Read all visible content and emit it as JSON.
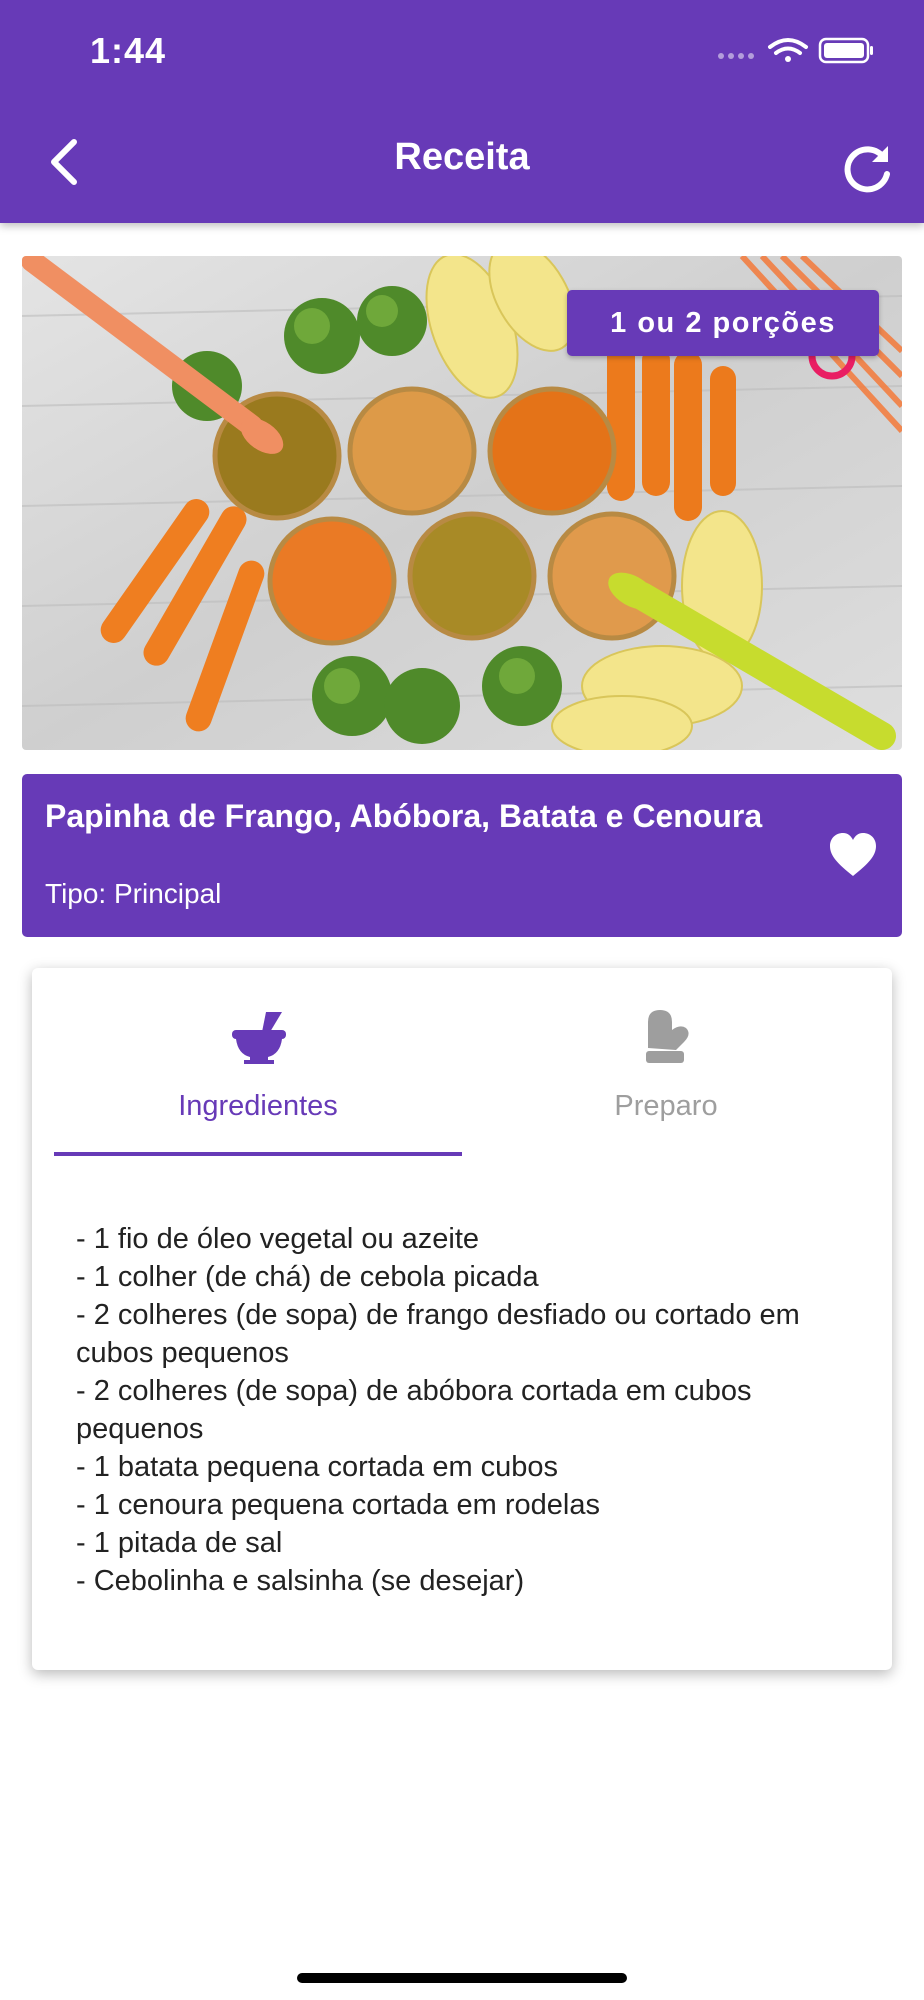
{
  "status_bar": {
    "time": "1:44"
  },
  "header": {
    "title": "Receita"
  },
  "hero": {
    "portions_badge": "1 ou 2 porções"
  },
  "recipe": {
    "name": "Papinha de Frango, Abóbora, Batata e Cenoura",
    "type": "Tipo: Principal"
  },
  "tabs": [
    {
      "label": "Ingredientes",
      "active": true,
      "icon": "mortar-pestle-icon"
    },
    {
      "label": "Preparo",
      "active": false,
      "icon": "oven-mitt-icon"
    }
  ],
  "ingredients": [
    "- 1 fio de óleo vegetal ou azeite",
    "- 1 colher (de chá) de cebola picada",
    "- 2 colheres (de sopa) de frango desfiado ou cortado em cubos pequenos",
    "- 2 colheres (de sopa) de abóbora cortada em cubos pequenos",
    "- 1 batata pequena cortada em cubos",
    "- 1 cenoura pequena cortada em rodelas",
    "- 1 pitada de sal",
    "- Cebolinha e salsinha (se desejar)"
  ],
  "colors": {
    "accent": "#673ab7",
    "inactive_tab": "#9e9e9e",
    "text": "#222222"
  }
}
